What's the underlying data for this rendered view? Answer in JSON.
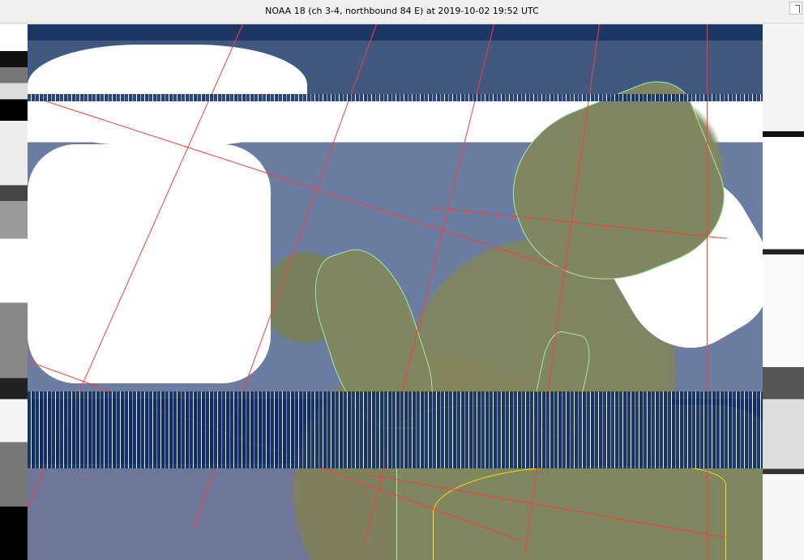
{
  "window": {
    "title": "NOAA 18 (ch 3-4, northbound 84 E) at 2019-10-02  19:52 UTC"
  },
  "image": {
    "marker_icon": "cross-icon",
    "colors": {
      "ocean": "#1d3765",
      "land": "#7f8660",
      "clouds": "#ffffff",
      "grid": "#ff3b3b",
      "borders": "#ffe600",
      "coastlines": "#9cf0a2"
    }
  }
}
